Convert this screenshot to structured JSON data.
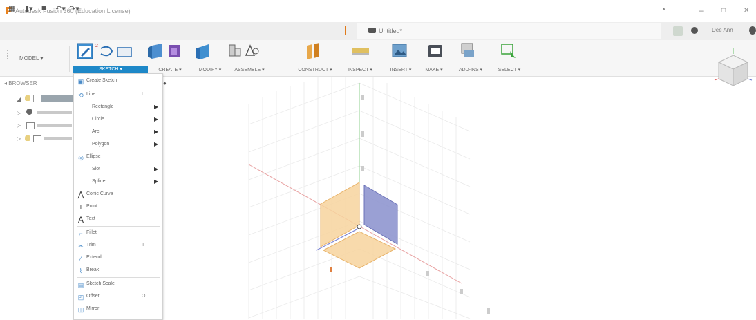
{
  "window": {
    "title": "Autodesk Fusion 360 (Education License)",
    "controls": [
      "–",
      "□",
      "✕"
    ]
  },
  "tabs": {
    "document_title": "Untitled*",
    "user": "Dee Ann"
  },
  "toolbar": {
    "workspace": "MODEL ▾",
    "groups": [
      {
        "label": "SKETCH ▾"
      },
      {
        "label": "CREATE ▾"
      },
      {
        "label": "MODIFY ▾"
      },
      {
        "label": "ASSEMBLE ▾"
      },
      {
        "label": "CONSTRUCT ▾"
      },
      {
        "label": "INSPECT ▾"
      },
      {
        "label": "INSERT ▾"
      },
      {
        "label": "MAKE ▾"
      },
      {
        "label": "ADD-INS ▾"
      },
      {
        "label": "SELECT ▾"
      }
    ]
  },
  "browser": {
    "header": "BROWSER"
  },
  "sketch_menu": {
    "items": [
      {
        "label": "Create Sketch",
        "icon": "create-sketch-icon",
        "shortcut": "",
        "submenu": false
      },
      {
        "label": "Line",
        "icon": "line-icon",
        "shortcut": "L",
        "submenu": false
      },
      {
        "label": "Rectangle",
        "icon": "",
        "shortcut": "",
        "submenu": true
      },
      {
        "label": "Circle",
        "icon": "",
        "shortcut": "",
        "submenu": true
      },
      {
        "label": "Arc",
        "icon": "",
        "shortcut": "",
        "submenu": true
      },
      {
        "label": "Polygon",
        "icon": "",
        "shortcut": "",
        "submenu": true
      },
      {
        "label": "Ellipse",
        "icon": "ellipse-icon",
        "shortcut": "",
        "submenu": false
      },
      {
        "label": "Slot",
        "icon": "",
        "shortcut": "",
        "submenu": true
      },
      {
        "label": "Spline",
        "icon": "",
        "shortcut": "",
        "submenu": true
      },
      {
        "label": "Conic Curve",
        "icon": "conic-curve-icon",
        "shortcut": "",
        "submenu": false
      },
      {
        "label": "Point",
        "icon": "point-icon",
        "shortcut": "",
        "submenu": false
      },
      {
        "label": "Text",
        "icon": "text-icon",
        "shortcut": "",
        "submenu": false
      },
      {
        "label": "Fillet",
        "icon": "fillet-icon",
        "shortcut": "",
        "submenu": false
      },
      {
        "label": "Trim",
        "icon": "trim-icon",
        "shortcut": "T",
        "submenu": false
      },
      {
        "label": "Extend",
        "icon": "extend-icon",
        "shortcut": "",
        "submenu": false
      },
      {
        "label": "Break",
        "icon": "break-icon",
        "shortcut": "",
        "submenu": false
      },
      {
        "label": "Sketch Scale",
        "icon": "sketch-scale-icon",
        "shortcut": "",
        "submenu": false
      },
      {
        "label": "Offset",
        "icon": "offset-icon",
        "shortcut": "O",
        "submenu": false
      },
      {
        "label": "Mirror",
        "icon": "mirror-icon",
        "shortcut": "",
        "submenu": false
      }
    ]
  },
  "colors": {
    "accent_blue": "#1e88c8",
    "plane_orange": "#f5c98a",
    "plane_blue": "#8f96cf",
    "axis_red": "#e59a9a",
    "axis_green": "#8fd18f",
    "brand_orange": "#e8821e"
  }
}
